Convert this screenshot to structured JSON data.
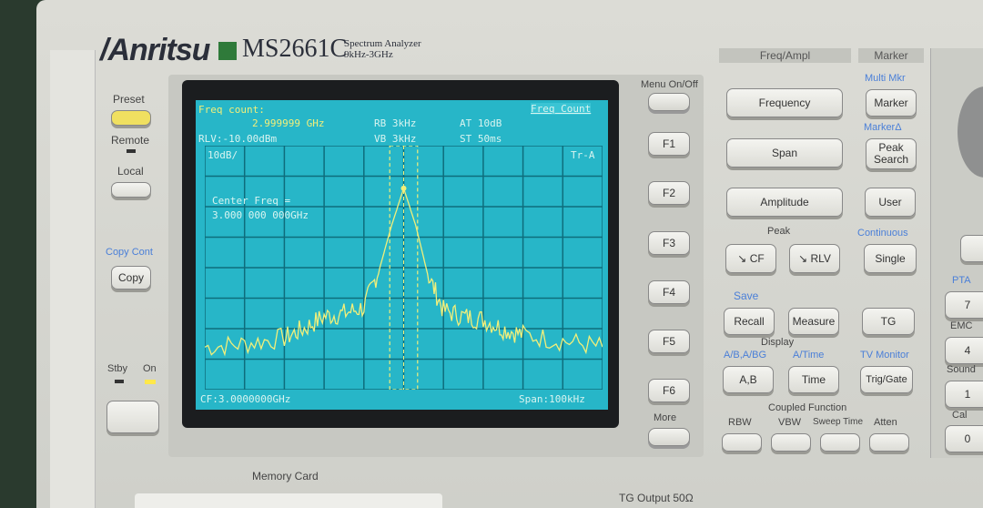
{
  "brand": {
    "logo": "Anritsu",
    "model": "MS2661C",
    "subtitle": "Spectrum Analyzer",
    "range": "9kHz-3GHz"
  },
  "left": {
    "preset": "Preset",
    "remote": "Remote",
    "local": "Local",
    "copy_cont": "Copy Cont",
    "copy": "Copy",
    "stby": "Stby",
    "on": "On"
  },
  "screen": {
    "freq_count_label": "Freq count:",
    "freq_count_value": "2.999999 GHz",
    "mode": "Freq Count",
    "rlv": "RLV:-10.00dBm",
    "rb": "RB 3kHz",
    "vb": "VB 3kHz",
    "at": "AT 10dB",
    "st": "ST 50ms",
    "scale": "10dB/",
    "trace": "Tr-A",
    "center_label": "Center Freq =",
    "center_value": "3.000 000 000GHz",
    "cf": "CF:3.0000000GHz",
    "span": "Span:100kHz"
  },
  "softkeys": {
    "menu": "Menu On/Off",
    "keys": [
      "F1",
      "F2",
      "F3",
      "F4",
      "F5",
      "F6"
    ],
    "more": "More"
  },
  "freq_ampl": {
    "title": "Freq/Ampl",
    "frequency": "Frequency",
    "span": "Span",
    "amplitude": "Amplitude",
    "peak": "Peak",
    "to_cf": "CF",
    "to_rlv": "RLV"
  },
  "marker": {
    "title": "Marker",
    "multi_mkr": "Multi Mkr",
    "marker": "Marker",
    "marker_delta": "MarkerΔ",
    "peak_search": "Peak Search",
    "user": "User",
    "continuous": "Continuous",
    "single": "Single"
  },
  "misc": {
    "save": "Save",
    "recall": "Recall",
    "measure": "Measure",
    "tg": "TG",
    "display": "Display",
    "ab_abg": "A/B,A/BG",
    "a_time": "A/Time",
    "tv_monitor": "TV Monitor",
    "ab": "A,B",
    "time": "Time",
    "trig_gate": "Trig/Gate",
    "coupled": "Coupled Function",
    "rbw": "RBW",
    "vbw": "VBW",
    "sweep_time": "Sweep Time",
    "atten": "Atten"
  },
  "keypad": {
    "pta": "PTA",
    "emc": "EMC",
    "sound": "Sound",
    "cal": "Cal",
    "keys": [
      "7",
      "4",
      "1",
      "0"
    ]
  },
  "bottom": {
    "memory_card": "Memory Card",
    "tg_output": "TG Output 50Ω"
  },
  "colors": {
    "screen": "#27b6c8",
    "trace": "#f2ef7a",
    "grid": "#0e6d7c"
  },
  "chart_data": {
    "type": "line",
    "center_freq_ghz": 3.0,
    "span_khz": 100,
    "ref_level_dbm": -10,
    "scale_db_per_div": 10,
    "xlim_khz": [
      -50,
      50
    ],
    "ylim_dbm": [
      -90,
      -10
    ],
    "grid": true,
    "x_khz": [
      -50,
      -40,
      -30,
      -25,
      -20,
      -15,
      -10,
      -6,
      -3,
      0,
      3,
      6,
      10,
      15,
      20,
      25,
      30,
      40,
      50
    ],
    "y_dbm": [
      -76,
      -75,
      -73,
      -70,
      -66,
      -65,
      -63,
      -50,
      -36,
      -24,
      -36,
      -52,
      -64,
      -66,
      -67,
      -70,
      -72,
      -74,
      -76
    ]
  }
}
